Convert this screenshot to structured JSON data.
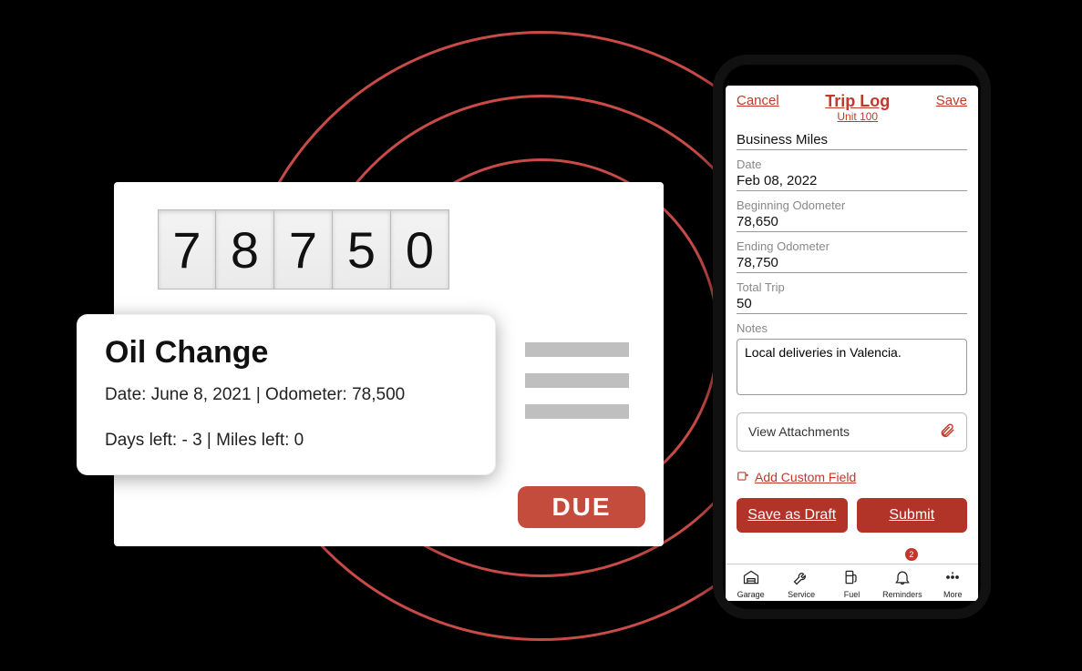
{
  "odometer": {
    "digits": [
      "7",
      "8",
      "7",
      "5",
      "0"
    ]
  },
  "popup": {
    "title": "Oil Change",
    "line1": "Date: June 8, 2021 | Odometer: 78,500",
    "line2": "Days left: - 3 | Miles left: 0"
  },
  "due_label": "DUE",
  "phone": {
    "cancel": "Cancel",
    "save": "Save",
    "title": "Trip Log",
    "subtitle": "Unit 100",
    "heading": "Business Miles",
    "fields": {
      "date_label": "Date",
      "date_value": "Feb 08, 2022",
      "begin_label": "Beginning Odometer",
      "begin_value": "78,650",
      "end_label": "Ending Odometer",
      "end_value": "78,750",
      "total_label": "Total Trip",
      "total_value": "50",
      "notes_label": "Notes",
      "notes_value": "Local deliveries in Valencia."
    },
    "attachments": "View Attachments",
    "add_custom": "Add Custom Field",
    "save_draft": "Save as Draft",
    "submit": "Submit",
    "tabs": {
      "garage": "Garage",
      "service": "Service",
      "fuel": "Fuel",
      "reminders": "Reminders",
      "more": "More",
      "badge": "2"
    }
  }
}
